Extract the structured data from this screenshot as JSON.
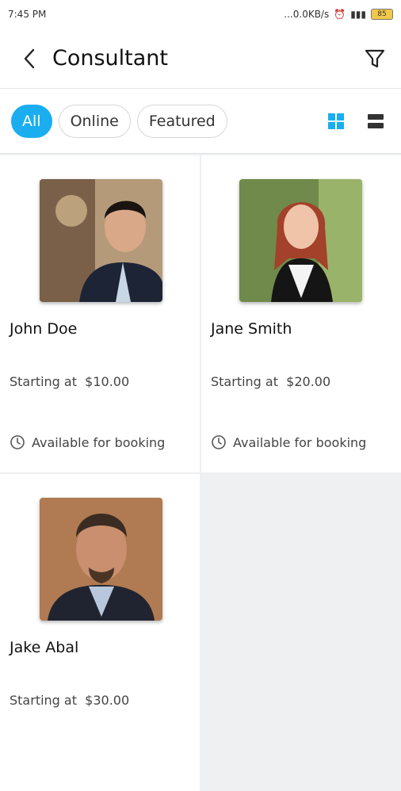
{
  "status_bar": {
    "time": "7:45 PM",
    "network_speed": "...0.0KB/s",
    "battery_level": "85"
  },
  "header": {
    "title": "Consultant",
    "back_icon": "chevron-left-icon",
    "filter_icon": "funnel-icon"
  },
  "filters": {
    "chips": [
      {
        "label": "All",
        "active": true
      },
      {
        "label": "Online",
        "active": false
      },
      {
        "label": "Featured",
        "active": false
      }
    ],
    "grid_view_icon": "grid-icon",
    "list_view_icon": "list-icon",
    "accent_color": "#1aaef0"
  },
  "consultants": [
    {
      "name": "John Doe",
      "price_label": "Starting at",
      "price": "$10.00",
      "availability": "Available for booking"
    },
    {
      "name": "Jane Smith",
      "price_label": "Starting at",
      "price": "$20.00",
      "availability": "Available for booking"
    },
    {
      "name": "Jake Abal",
      "price_label": "Starting at",
      "price": "$30.00"
    }
  ]
}
